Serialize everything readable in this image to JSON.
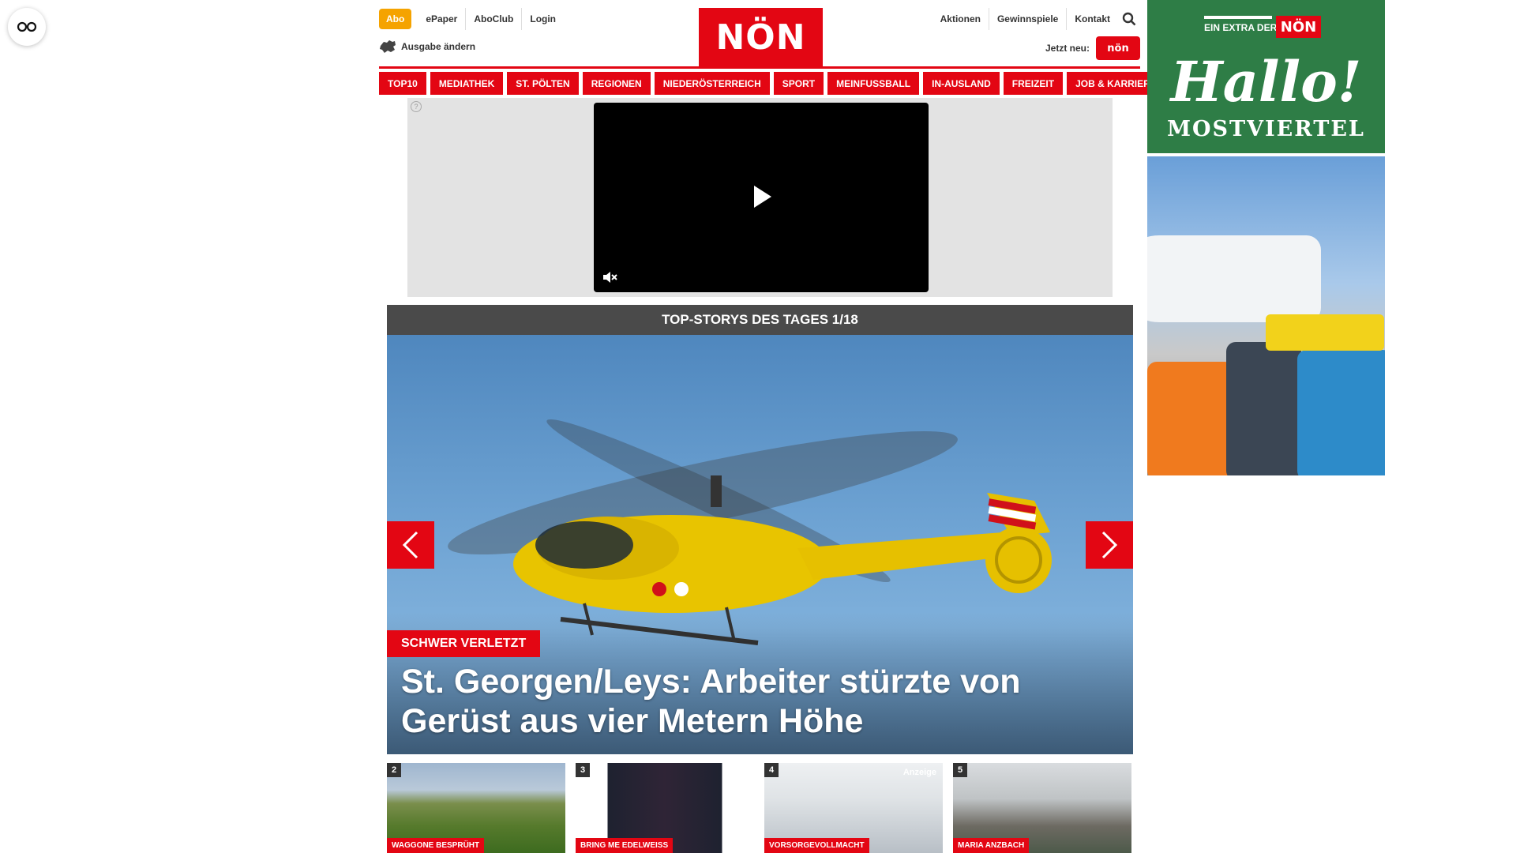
{
  "header": {
    "abo": "Abo",
    "top_links": [
      "ePaper",
      "AboClub",
      "Login"
    ],
    "ausgabe": "Ausgabe ändern",
    "logo": "NÖN",
    "right_links": [
      "Aktionen",
      "Gewinnspiele",
      "Kontakt"
    ],
    "jetzt_neu": "Jetzt neu:",
    "jetzt_badge": "nön"
  },
  "nav": {
    "items": [
      "TOP10",
      "MEDIATHEK",
      "ST. PÖLTEN",
      "REGIONEN",
      "NIEDERÖSTERREICH",
      "SPORT",
      "MEINFUSSBALL",
      "IN-AUSLAND",
      "FREIZEIT",
      "JOB & KARRIERE"
    ]
  },
  "ad": {
    "info": "?"
  },
  "stories": {
    "heading": "TOP-STORYS DES TAGES 1/18",
    "hero_tag": "SCHWER VERLETZT",
    "hero_title": "St. Georgen/Leys: Arbeiter stürzte von Gerüst aus vier Metern Höhe",
    "thumbs": [
      {
        "num": "2",
        "tag": "WAGGONE BESPRÜHT"
      },
      {
        "num": "3",
        "tag": "BRING ME EDELWEISS"
      },
      {
        "num": "4",
        "tag": "VORSORGEVOLLMACHT",
        "anzeige": "Anzeige"
      },
      {
        "num": "5",
        "tag": "MARIA ANZBACH"
      }
    ]
  },
  "side_ad": {
    "extra": "EIN EXTRA DER",
    "extra_logo": "NÖN",
    "hallo": "Hallo!",
    "region": "MOSTVIERTEL"
  },
  "colors": {
    "brand_red": "#e30613",
    "abo_orange": "#f5a300",
    "story_head": "#4a4a4a",
    "ad_green": "#2e7d46"
  }
}
